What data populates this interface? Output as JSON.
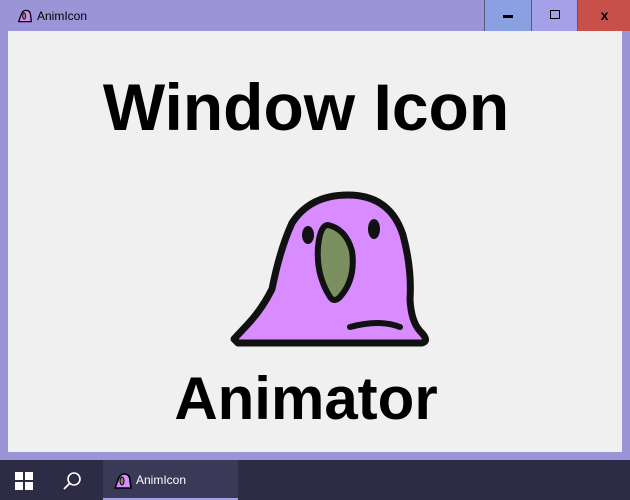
{
  "window": {
    "title": "AnimIcon",
    "app_icon": "parrot-icon",
    "controls": {
      "minimize_icon": "minimize-icon",
      "maximize_icon": "maximize-icon",
      "close_label": "x"
    }
  },
  "content": {
    "heading": "Window Icon",
    "subheading": "Animator",
    "illustration": "parrot-illustration"
  },
  "taskbar": {
    "start_icon": "windows-start-icon",
    "search_icon": "search-icon",
    "items": [
      {
        "label": "AnimIcon",
        "icon": "parrot-icon",
        "active": true
      }
    ]
  },
  "colors": {
    "frame": "#9b95d8",
    "client_bg": "#f0f0f0",
    "minimize_bg": "#8aa0e0",
    "maximize_bg": "#a6a0e8",
    "close_bg": "#c7504a",
    "parrot_body": "#d88cff",
    "parrot_beak": "#7b8f60",
    "taskbar_bg": "#2d2b46"
  }
}
